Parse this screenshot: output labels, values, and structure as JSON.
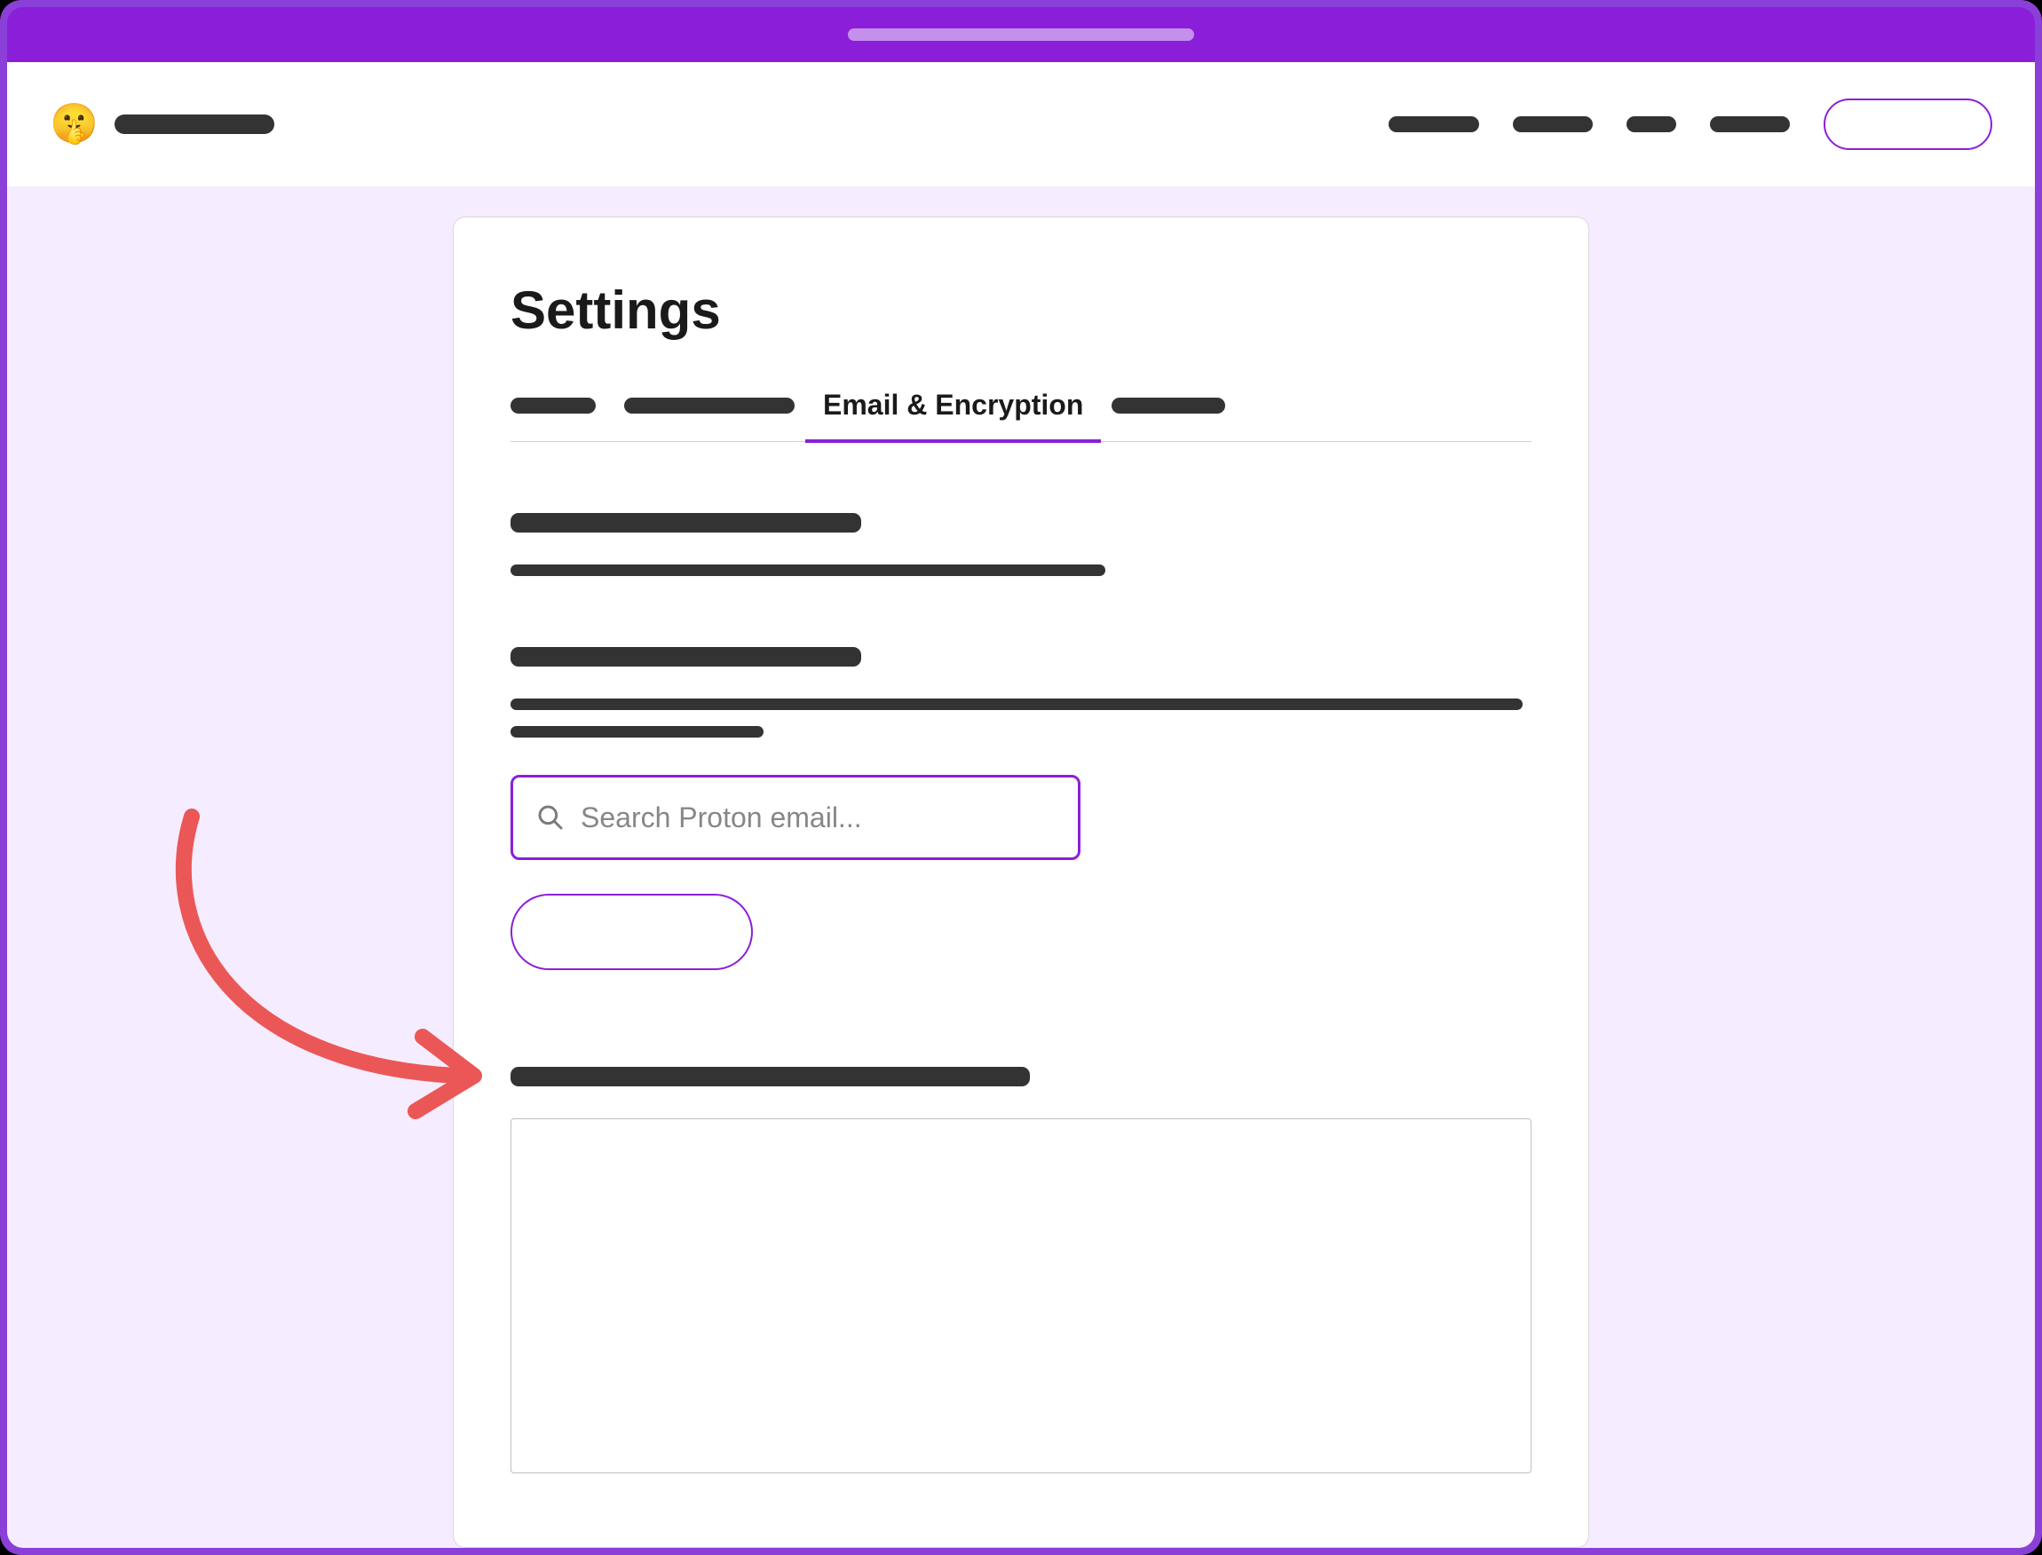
{
  "header": {
    "logo_emoji": "🤫"
  },
  "page": {
    "title": "Settings"
  },
  "tabs": {
    "active_label": "Email & Encryption"
  },
  "search": {
    "placeholder": "Search Proton email..."
  },
  "colors": {
    "accent": "#8b1fd9",
    "arrow": "#eb5757"
  }
}
